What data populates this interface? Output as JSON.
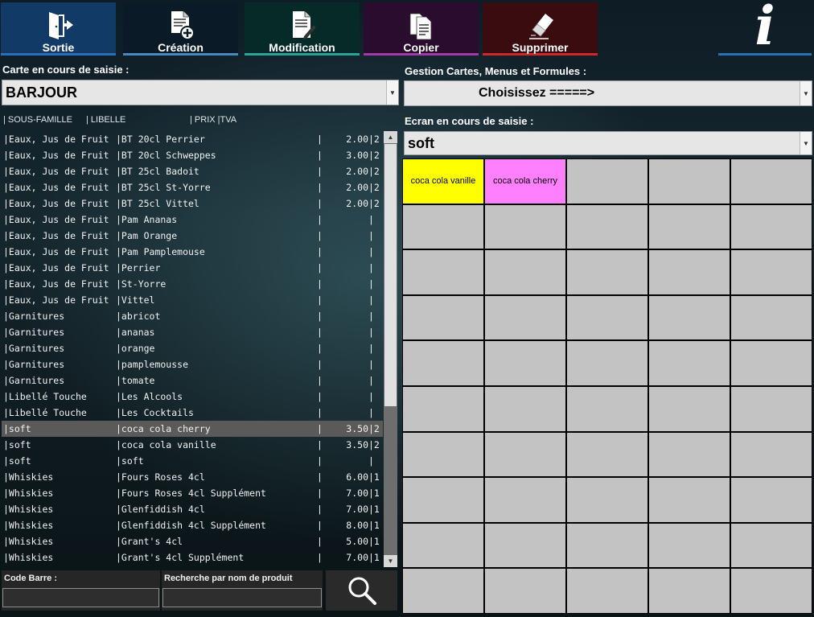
{
  "toolbar": {
    "sortie": "Sortie",
    "creation": "Création",
    "modification": "Modification",
    "copier": "Copier",
    "supprimer": "Supprimer",
    "info": "i"
  },
  "carte": {
    "label": "Carte en cours de saisie :",
    "value": "BARJOUR"
  },
  "gestion": {
    "label": "Gestion Cartes, Menus et Formules  :",
    "value": "Choisissez  =====>"
  },
  "ecran": {
    "label": "Ecran en cours de saisie :",
    "value": "soft"
  },
  "list_headers": {
    "sous_famille": "| SOUS-FAMILLE",
    "libelle": "| LIBELLE",
    "prix_tva": "| PRIX  |TVA"
  },
  "rows": [
    {
      "famille": "|Eaux, Jus de Fruit",
      "libelle": "|BT 20cl Perrier",
      "sep": "|",
      "prix": "2.00",
      "tva": "|2"
    },
    {
      "famille": "|Eaux, Jus de Fruit",
      "libelle": "|BT 20cl Schweppes",
      "sep": "|",
      "prix": "3.00",
      "tva": "|2"
    },
    {
      "famille": "|Eaux, Jus de Fruit",
      "libelle": "|BT 25cl Badoit",
      "sep": "|",
      "prix": "2.00",
      "tva": "|2"
    },
    {
      "famille": "|Eaux, Jus de Fruit",
      "libelle": "|BT 25cl St-Yorre",
      "sep": "|",
      "prix": "2.00",
      "tva": "|2"
    },
    {
      "famille": "|Eaux, Jus de Fruit",
      "libelle": "|BT 25cl Vittel",
      "sep": "|",
      "prix": "2.00",
      "tva": "|2"
    },
    {
      "famille": "|Eaux, Jus de Fruit",
      "libelle": "|Pam Ananas",
      "sep": "|",
      "prix": "",
      "tva": "|"
    },
    {
      "famille": "|Eaux, Jus de Fruit",
      "libelle": "|Pam Orange",
      "sep": "|",
      "prix": "",
      "tva": "|"
    },
    {
      "famille": "|Eaux, Jus de Fruit",
      "libelle": "|Pam Pamplemouse",
      "sep": "|",
      "prix": "",
      "tva": "|"
    },
    {
      "famille": "|Eaux, Jus de Fruit",
      "libelle": "|Perrier",
      "sep": "|",
      "prix": "",
      "tva": "|"
    },
    {
      "famille": "|Eaux, Jus de Fruit",
      "libelle": "|St-Yorre",
      "sep": "|",
      "prix": "",
      "tva": "|"
    },
    {
      "famille": "|Eaux, Jus de Fruit",
      "libelle": "|Vittel",
      "sep": "|",
      "prix": "",
      "tva": "|"
    },
    {
      "famille": "|Garnitures",
      "libelle": "|abricot",
      "sep": "|",
      "prix": "",
      "tva": "|"
    },
    {
      "famille": "|Garnitures",
      "libelle": "|ananas",
      "sep": "|",
      "prix": "",
      "tva": "|"
    },
    {
      "famille": "|Garnitures",
      "libelle": "|orange",
      "sep": "|",
      "prix": "",
      "tva": "|"
    },
    {
      "famille": "|Garnitures",
      "libelle": "|pamplemousse",
      "sep": "|",
      "prix": "",
      "tva": "|"
    },
    {
      "famille": "|Garnitures",
      "libelle": "|tomate",
      "sep": "|",
      "prix": "",
      "tva": "|"
    },
    {
      "famille": "|Libellé Touche",
      "libelle": "|Les Alcools",
      "sep": "|",
      "prix": "",
      "tva": "|"
    },
    {
      "famille": "|Libellé Touche",
      "libelle": "|Les Cocktails",
      "sep": "|",
      "prix": "",
      "tva": "|"
    },
    {
      "famille": "|soft",
      "libelle": "|coca cola cherry",
      "sep": "|",
      "prix": "3.50",
      "tva": "|2",
      "selected": true
    },
    {
      "famille": "|soft",
      "libelle": "|coca cola vanille",
      "sep": "|",
      "prix": "3.50",
      "tva": "|2"
    },
    {
      "famille": "|soft",
      "libelle": "|soft",
      "sep": "|",
      "prix": "",
      "tva": "|"
    },
    {
      "famille": "|Whiskies",
      "libelle": "|Fours Roses 4cl",
      "sep": "|",
      "prix": "6.00",
      "tva": "|1"
    },
    {
      "famille": "|Whiskies",
      "libelle": "|Fours Roses 4cl Supplément",
      "sep": "|",
      "prix": "7.00",
      "tva": "|1"
    },
    {
      "famille": "|Whiskies",
      "libelle": "|Glenfiddish 4cl",
      "sep": "|",
      "prix": "7.00",
      "tva": "|1"
    },
    {
      "famille": "|Whiskies",
      "libelle": "|Glenfiddish 4cl Supplément",
      "sep": "|",
      "prix": "8.00",
      "tva": "|1"
    },
    {
      "famille": "|Whiskies",
      "libelle": "|Grant's 4cl",
      "sep": "|",
      "prix": "5.00",
      "tva": "|1"
    },
    {
      "famille": "|Whiskies",
      "libelle": "|Grant's 4cl Supplément",
      "sep": "|",
      "prix": "7.00",
      "tva": "|1"
    }
  ],
  "search": {
    "code_barre_label": "Code Barre :",
    "nom_label": "Recherche par nom de produit",
    "code_barre_value": "",
    "nom_value": ""
  },
  "grid_keys": [
    {
      "label": "coca cola vanille",
      "color": "#ffff00"
    },
    {
      "label": "coca cola cherry",
      "color": "#ff80ff"
    }
  ],
  "colors": {
    "key_empty": "#c3c3c3",
    "selected_row": "#5a5a5a"
  }
}
